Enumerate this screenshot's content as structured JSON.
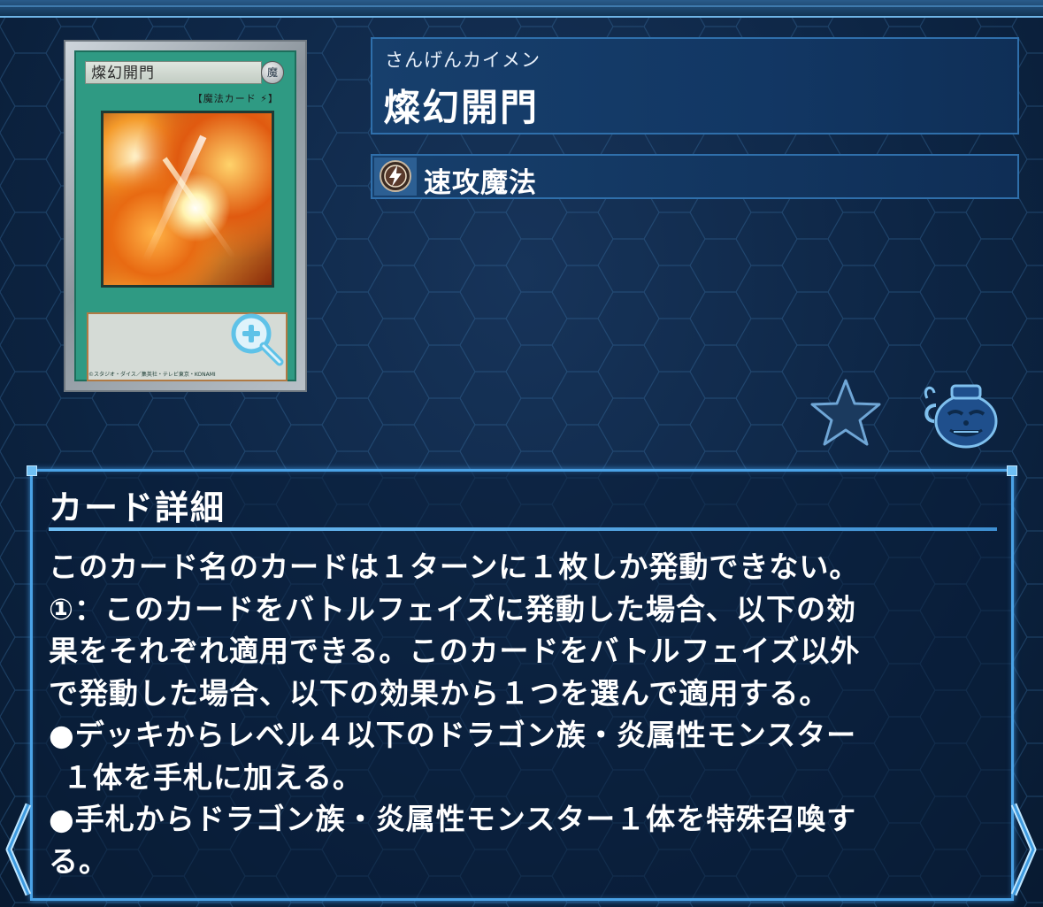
{
  "card": {
    "name": "燦幻開門",
    "ruby": "さんげんカイメン",
    "type_line": "【魔法カード",
    "type_mark": "⚡",
    "attribute": "魔",
    "footer": "©スタジオ・ダイス／集英社・テレビ東京・KONAMI"
  },
  "type_panel": {
    "label": "速攻魔法",
    "icon": "quick-play-spell-icon"
  },
  "detail": {
    "title": "カード詳細",
    "lines": [
      "このカード名のカードは１ターンに１枚しか発動できない。",
      "①：このカードをバトルフェイズに発動した場合、以下の効",
      "果をそれぞれ適用できる。このカードをバトルフェイズ以外",
      "で発動した場合、以下の効果から１つを選んで適用する。",
      "●デッキからレベル４以下のドラゴン族・炎属性モンスター",
      "１体を手札に加える。",
      "●手札からドラゴン族・炎属性モンスター１体を特殊召喚す",
      "る。"
    ]
  },
  "icons": {
    "zoom": "zoom-in-icon",
    "favorite": "star-icon",
    "pot": "pot-of-greed-icon",
    "nav_prev": "chevron-left-icon",
    "nav_next": "chevron-right-icon"
  },
  "colors": {
    "panel_border": "#2f6fab",
    "detail_border": "#4aa2e6",
    "card_green": "#2f9a83",
    "background": "#0b2240"
  }
}
